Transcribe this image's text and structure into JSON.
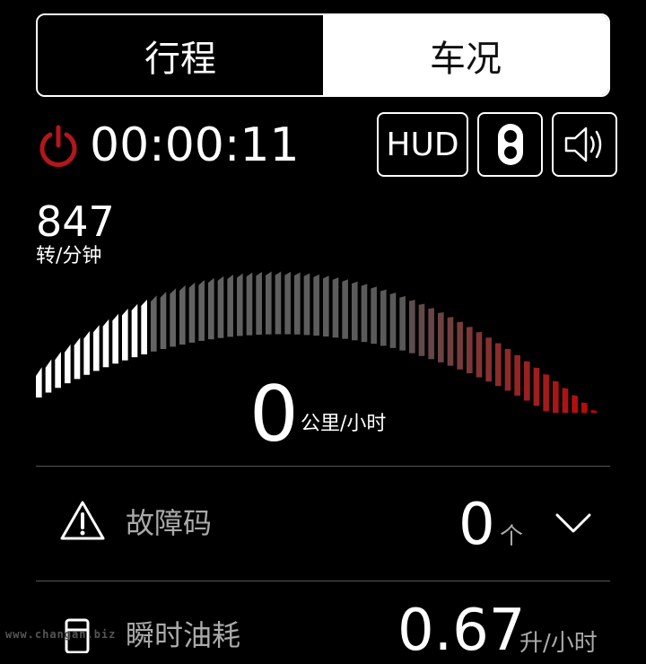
{
  "tabs": [
    {
      "label": "行程",
      "active": true
    },
    {
      "label": "车况",
      "active": false
    }
  ],
  "trip": {
    "timer": "00:00:11",
    "power_icon": "power-icon",
    "power_color": "#b3161b"
  },
  "buttons": {
    "hud_label": "HUD",
    "light_icon": "traffic-light-icon",
    "sound_icon": "speaker-icon"
  },
  "rpm": {
    "value": "847",
    "unit": "转/分钟",
    "lit_bars": 12,
    "total_bars": 60
  },
  "speed": {
    "value": "0",
    "unit": "公里/小时"
  },
  "fault_code": {
    "icon": "warning-icon",
    "label": "故障码",
    "value": "0",
    "unit": "个",
    "expand_icon": "chevron-down-icon"
  },
  "fuel": {
    "icon": "fuel-pump-icon",
    "label": "瞬时油耗",
    "value": "0.67",
    "unit": "升/小时"
  },
  "watermark": "www.changan.biz"
}
